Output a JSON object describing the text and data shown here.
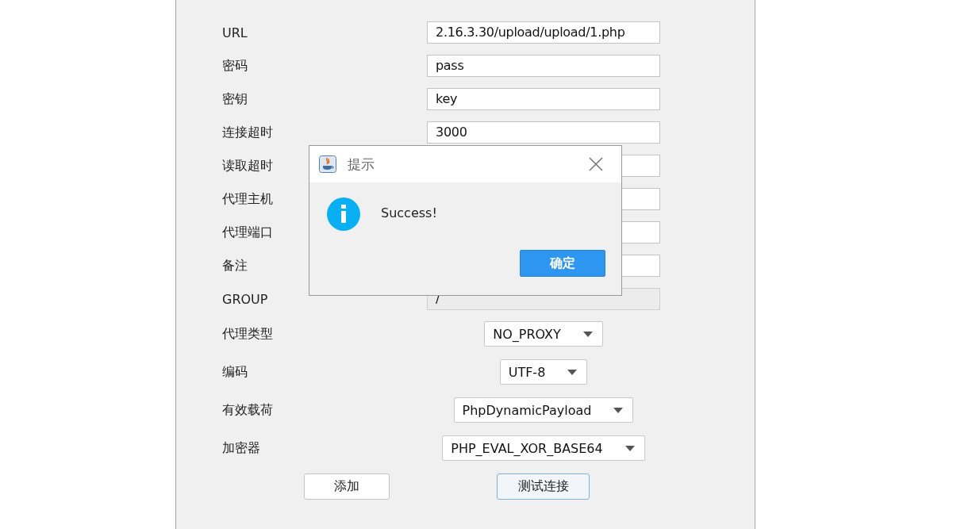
{
  "form": {
    "fields": [
      {
        "label": "URL",
        "value": "2.16.3.30/upload/upload/1.php",
        "disabled": false
      },
      {
        "label": "密码",
        "value": "pass",
        "disabled": false
      },
      {
        "label": "密钥",
        "value": "key",
        "disabled": false
      },
      {
        "label": "连接超时",
        "value": "3000",
        "disabled": false
      },
      {
        "label": "读取超时",
        "disabled": false
      },
      {
        "label": "代理主机",
        "disabled": false
      },
      {
        "label": "代理端口",
        "disabled": false
      },
      {
        "label": "备注",
        "disabled": false
      },
      {
        "label": "GROUP",
        "value": "/",
        "disabled": true
      }
    ],
    "selects": [
      {
        "label": "代理类型",
        "value": "NO_PROXY"
      },
      {
        "label": "编码",
        "value": "UTF-8"
      },
      {
        "label": "有效载荷",
        "value": "PhpDynamicPayload"
      },
      {
        "label": "加密器",
        "value": "PHP_EVAL_XOR_BASE64"
      }
    ],
    "buttons": [
      {
        "label": "添加",
        "focused": false
      },
      {
        "label": "测试连接",
        "focused": true
      }
    ]
  },
  "dialog": {
    "title": "提示",
    "message": "Success!",
    "buttons": [
      {
        "label": "确定"
      }
    ]
  }
}
